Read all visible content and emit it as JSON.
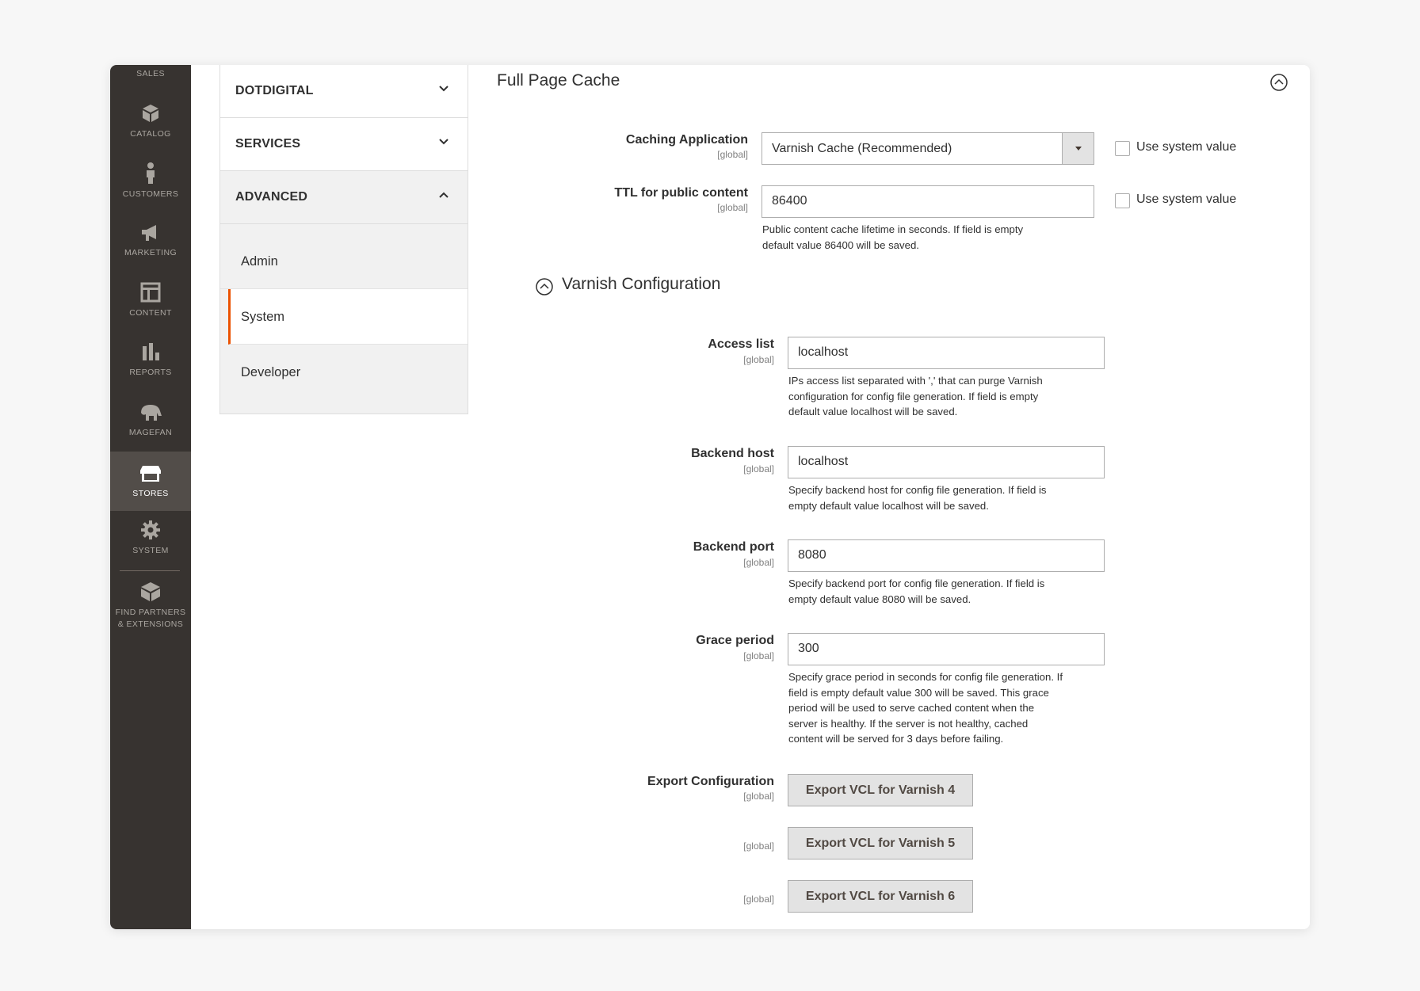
{
  "admin_menu": {
    "items": [
      {
        "label": "SALES",
        "icon": "dollar-icon"
      },
      {
        "label": "CATALOG",
        "icon": "cube-icon"
      },
      {
        "label": "CUSTOMERS",
        "icon": "person-icon"
      },
      {
        "label": "MARKETING",
        "icon": "megaphone-icon"
      },
      {
        "label": "CONTENT",
        "icon": "layout-icon"
      },
      {
        "label": "REPORTS",
        "icon": "bar-chart-icon"
      },
      {
        "label": "MAGEFAN",
        "icon": "mammoth-icon"
      },
      {
        "label": "STORES",
        "icon": "storefront-icon",
        "active": true
      },
      {
        "label": "SYSTEM",
        "icon": "gear-icon"
      },
      {
        "label": "FIND PARTNERS & EXTENSIONS",
        "icon": "box-icon"
      }
    ]
  },
  "tabs": {
    "groups": [
      {
        "label": "DOTDIGITAL",
        "expanded": false
      },
      {
        "label": "SERVICES",
        "expanded": false
      },
      {
        "label": "ADVANCED",
        "expanded": true
      }
    ],
    "advanced_items": [
      {
        "label": "Admin"
      },
      {
        "label": "System",
        "active": true
      },
      {
        "label": "Developer"
      }
    ]
  },
  "section": {
    "title": "Full Page Cache",
    "caching_application": {
      "label": "Caching Application",
      "scope": "[global]",
      "value": "Varnish Cache (Recommended)",
      "use_system_value": "Use system value"
    },
    "ttl": {
      "label": "TTL for public content",
      "scope": "[global]",
      "value": "86400",
      "use_system_value": "Use system value",
      "note_line1": "Public content cache lifetime in seconds. If field is empty",
      "note_line2": "default value 86400 will be saved."
    },
    "varnish": {
      "title": "Varnish Configuration",
      "access_list": {
        "label": "Access list",
        "scope": "[global]",
        "value": "localhost",
        "note_line1": "IPs access list separated with ',' that can purge Varnish",
        "note_line2": "configuration for config file generation. If field is empty",
        "note_line3": "default value localhost will be saved."
      },
      "backend_host": {
        "label": "Backend host",
        "scope": "[global]",
        "value": "localhost",
        "note_line1": "Specify backend host for config file generation. If field is",
        "note_line2": "empty default value localhost will be saved."
      },
      "backend_port": {
        "label": "Backend port",
        "scope": "[global]",
        "value": "8080",
        "note_line1": "Specify backend port for config file generation. If field is",
        "note_line2": "empty default value 8080 will be saved."
      },
      "grace_period": {
        "label": "Grace period",
        "scope": "[global]",
        "value": "300",
        "note_line1": "Specify grace period in seconds for config file generation. If",
        "note_line2": "field is empty default value 300 will be saved. This grace",
        "note_line3": "period will be used to serve cached content when the",
        "note_line4": "server is healthy. If the server is not healthy, cached",
        "note_line5": "content will be served for 3 days before failing."
      },
      "export": {
        "label": "Export Configuration",
        "scope1": "[global]",
        "scope2": "[global]",
        "scope3": "[global]",
        "btn_v4": "Export VCL for Varnish 4",
        "btn_v5": "Export VCL for Varnish 5",
        "btn_v6": "Export VCL for Varnish 6"
      }
    }
  }
}
